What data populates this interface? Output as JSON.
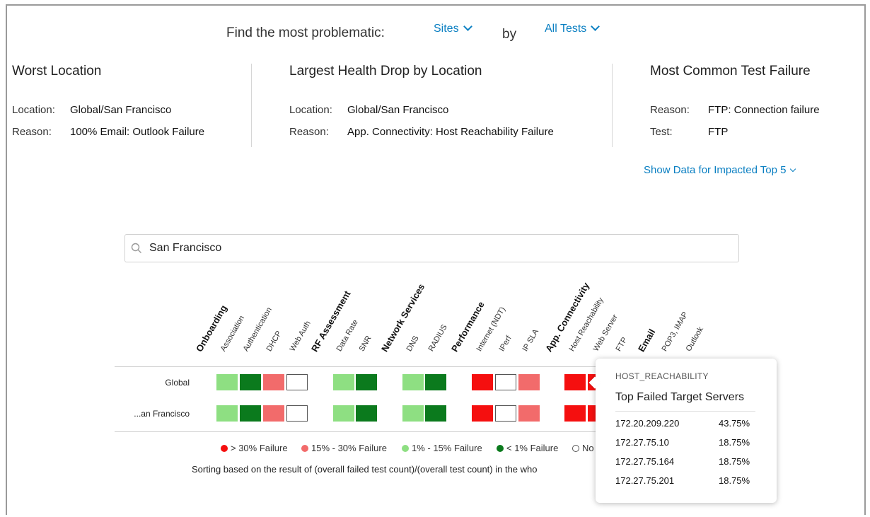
{
  "finder": {
    "label": "Find the most problematic:",
    "by_label": "by",
    "dimension_dropdown": "Sites",
    "test_dropdown": "All Tests"
  },
  "cards": [
    {
      "title": "Worst Location",
      "rows": [
        {
          "key": "Location:",
          "value": "Global/San Francisco"
        },
        {
          "key": "Reason:",
          "value": "100% Email: Outlook Failure"
        }
      ]
    },
    {
      "title": "Largest Health Drop by Location",
      "rows": [
        {
          "key": "Location:",
          "value": "Global/San Francisco"
        },
        {
          "key": "Reason:",
          "value": "App. Connectivity: Host Reachability Failure"
        }
      ]
    },
    {
      "title": "Most Common Test Failure",
      "rows": [
        {
          "key": "Reason:",
          "value": "FTP: Connection failure"
        },
        {
          "key": "Test:",
          "value": "FTP"
        }
      ]
    }
  ],
  "show_data_link": "Show Data for Impacted Top 5",
  "search": {
    "value": "San Francisco",
    "icon": "search-icon"
  },
  "heatmap": {
    "columns": [
      {
        "label": "Onboarding",
        "group": true
      },
      {
        "label": "Association",
        "group": false
      },
      {
        "label": "Authentication",
        "group": false
      },
      {
        "label": "DHCP",
        "group": false
      },
      {
        "label": "Web Auth",
        "group": false
      },
      {
        "label": "RF Assessment",
        "group": true
      },
      {
        "label": "Data Rate",
        "group": false
      },
      {
        "label": "SNR",
        "group": false
      },
      {
        "label": "Network Services",
        "group": true
      },
      {
        "label": "DNS",
        "group": false
      },
      {
        "label": "RADIUS",
        "group": false
      },
      {
        "label": "Performance",
        "group": true
      },
      {
        "label": "Internet (NDT)",
        "group": false
      },
      {
        "label": "IPerf",
        "group": false
      },
      {
        "label": "IP SLA",
        "group": false
      },
      {
        "label": "App. Connectivity",
        "group": true
      },
      {
        "label": "Host Reachability",
        "group": false
      },
      {
        "label": "Web Server",
        "group": false
      },
      {
        "label": "FTP",
        "group": false
      },
      {
        "label": "Email",
        "group": true
      },
      {
        "label": "POP3, IMAP",
        "group": false
      },
      {
        "label": "Outlook",
        "group": false
      }
    ],
    "rows": [
      {
        "label": "Global",
        "cells": [
          "light",
          "dark",
          "mid",
          "none",
          "light",
          "dark",
          "light",
          "dark",
          "red",
          "none",
          "mid",
          "red",
          "red"
        ]
      },
      {
        "label": "...an Francisco",
        "cells": [
          "light",
          "dark",
          "mid",
          "none",
          "light",
          "dark",
          "light",
          "dark",
          "red",
          "none",
          "mid",
          "red",
          "red"
        ]
      }
    ],
    "colors": {
      "red": "#f50f0f",
      "mid": "#f26b6b",
      "light": "#8edf82",
      "dark": "#0b7a1d",
      "none": "#ffffff"
    }
  },
  "legend": [
    {
      "key": "red",
      "label": "> 30% Failure"
    },
    {
      "key": "mid",
      "label": "15% - 30% Failure"
    },
    {
      "key": "light",
      "label": "1% - 15% Failure"
    },
    {
      "key": "dark",
      "label": "< 1% Failure"
    },
    {
      "key": "none",
      "label": "No"
    }
  ],
  "sorting_note": "Sorting based on the result of (overall failed test count)/(overall test count) in the who",
  "tooltip": {
    "category": "HOST_REACHABILITY",
    "title": "Top Failed Target Servers",
    "servers": [
      {
        "ip": "172.20.209.220",
        "pct": "43.75%"
      },
      {
        "ip": "172.27.75.10",
        "pct": "18.75%"
      },
      {
        "ip": "172.27.75.164",
        "pct": "18.75%"
      },
      {
        "ip": "172.27.75.201",
        "pct": "18.75%"
      }
    ]
  }
}
